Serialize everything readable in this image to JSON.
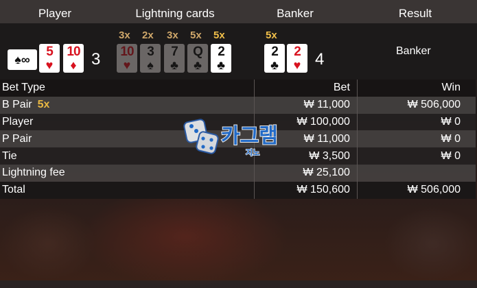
{
  "header": {
    "player": "Player",
    "lightning_cards": "Lightning cards",
    "banker": "Banker",
    "result": "Result"
  },
  "player": {
    "hidden_card": "♠∞",
    "cards": [
      {
        "rank": "5",
        "suit": "♥",
        "color": "#d8121f"
      },
      {
        "rank": "10",
        "suit": "♦",
        "color": "#d8121f"
      }
    ],
    "score": "3"
  },
  "lightning": {
    "multipliers": [
      "3x",
      "2x",
      "3x",
      "5x",
      "5x"
    ],
    "cards": [
      {
        "rank": "10",
        "suit": "♥",
        "color": "#d8121f",
        "active": false
      },
      {
        "rank": "3",
        "suit": "♠",
        "color": "#111111",
        "active": false
      },
      {
        "rank": "7",
        "suit": "♣",
        "color": "#111111",
        "active": false
      },
      {
        "rank": "Q",
        "suit": "♣",
        "color": "#111111",
        "active": false
      },
      {
        "rank": "2",
        "suit": "♣",
        "color": "#111111",
        "active": true
      }
    ]
  },
  "banker": {
    "multiplier": "5x",
    "cards": [
      {
        "rank": "2",
        "suit": "♣",
        "color": "#111111"
      },
      {
        "rank": "2",
        "suit": "♥",
        "color": "#d8121f"
      }
    ],
    "score": "4"
  },
  "result": "Banker",
  "table": {
    "headers": {
      "type": "Bet Type",
      "bet": "Bet",
      "win": "Win"
    },
    "rows": [
      {
        "type": "B Pair",
        "badge": "5x",
        "bet": "₩ 11,000",
        "win": "₩ 506,000"
      },
      {
        "type": "Player",
        "badge": "",
        "bet": "₩ 100,000",
        "win": "₩ 0"
      },
      {
        "type": "P Pair",
        "badge": "",
        "bet": "₩ 11,000",
        "win": "₩ 0"
      },
      {
        "type": "Tie",
        "badge": "",
        "bet": "₩ 3,500",
        "win": "₩ 0"
      },
      {
        "type": "Lightning fee",
        "badge": "",
        "bet": "₩ 25,100",
        "win": ""
      }
    ],
    "total": {
      "type": "Total",
      "bet": "₩ 150,600",
      "win": "₩ 506,000"
    }
  },
  "watermark": {
    "text": "카그램",
    "sub": "지노"
  },
  "colors": {
    "accent_gold": "#f0bf4a",
    "card_red": "#d8121f",
    "watermark_blue": "#1f6fd6"
  }
}
